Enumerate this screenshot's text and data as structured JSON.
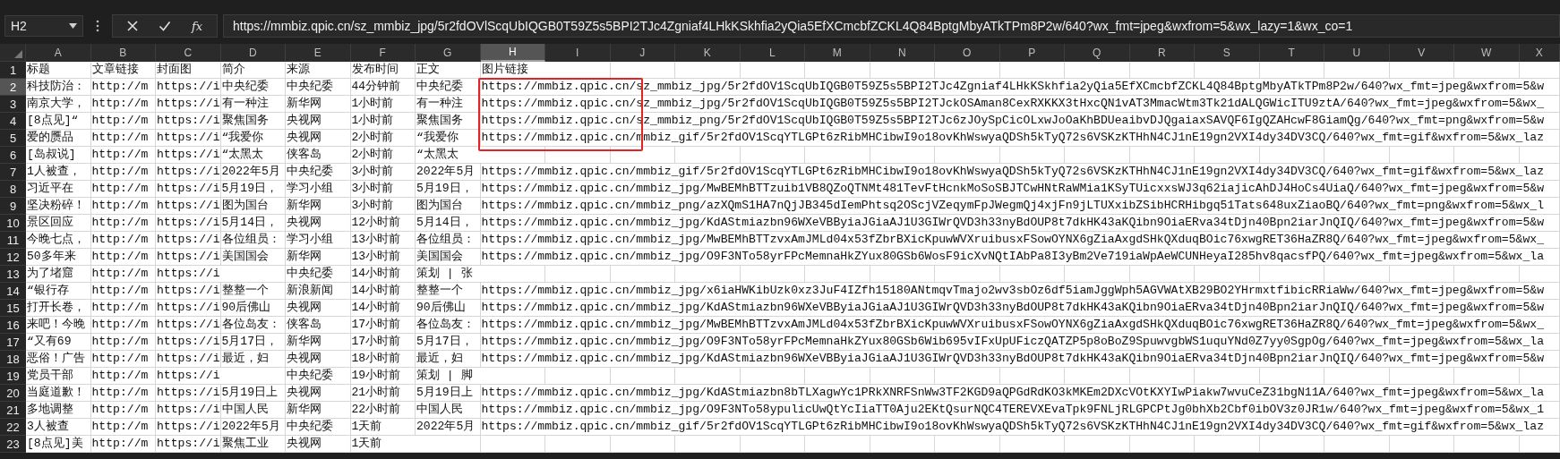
{
  "name_box": "H2",
  "formula_bar": {
    "buttons": [
      {
        "kind": "cancel"
      },
      {
        "kind": "enter"
      },
      {
        "kind": "function",
        "label": "fx"
      }
    ],
    "formula": "https://mmbiz.qpic.cn/sz_mmbiz_jpg/5r2fdOVlScqUbIQGB0T59Z5s5BPI2TJc4Zgniaf4LHkKSkhfia2yQia5EfXCmcbfZCKL4Q84BptgMbyATkTPm8P2w/640?wx_fmt=jpeg&wxfrom=5&wx_lazy=1&wx_co=1"
  },
  "columns": [
    {
      "label": "A",
      "selected": false
    },
    {
      "label": "B",
      "selected": false
    },
    {
      "label": "C",
      "selected": false
    },
    {
      "label": "D",
      "selected": false
    },
    {
      "label": "E",
      "selected": false
    },
    {
      "label": "F",
      "selected": false
    },
    {
      "label": "G",
      "selected": false
    },
    {
      "label": "H",
      "selected": true
    },
    {
      "label": "I",
      "selected": false
    },
    {
      "label": "J",
      "selected": false
    },
    {
      "label": "K",
      "selected": false
    },
    {
      "label": "L",
      "selected": false
    },
    {
      "label": "M",
      "selected": false
    },
    {
      "label": "N",
      "selected": false
    },
    {
      "label": "O",
      "selected": false
    },
    {
      "label": "P",
      "selected": false
    },
    {
      "label": "Q",
      "selected": false
    },
    {
      "label": "R",
      "selected": false
    },
    {
      "label": "S",
      "selected": false
    },
    {
      "label": "T",
      "selected": false
    },
    {
      "label": "U",
      "selected": false
    },
    {
      "label": "V",
      "selected": false
    },
    {
      "label": "W",
      "selected": false
    },
    {
      "label": "X",
      "selected": false
    }
  ],
  "rows": [
    {
      "number": "1",
      "selected": false,
      "boxed": false,
      "cells": {
        "A": "标题",
        "B": "文章链接",
        "C": "封面图",
        "D": "简介",
        "E": "来源",
        "F": "发布时间",
        "G": "正文",
        "H": "图片链接"
      }
    },
    {
      "number": "2",
      "selected": true,
      "boxed": true,
      "cells": {
        "A": "科技防治：",
        "B": "http://m",
        "C": "https://i",
        "D": "中央纪委",
        "E": "中央纪委",
        "F": "44分钟前",
        "G": "中央纪委",
        "H": "https://mmbiz.qpic.cn/sz_mmbiz_jpg/5r2fdOV1ScqUbIQGB0T59Z5s5BPI2TJc4Zgniaf4LHkKSkhfia2yQia5EfXCmcbfZCKL4Q84BptgMbyATkTPm8P2w/640?wx_fmt=jpeg&wxfrom=5&w"
      }
    },
    {
      "number": "3",
      "selected": false,
      "boxed": true,
      "cells": {
        "A": "南京大学，",
        "B": "http://m",
        "C": "https://i",
        "D": "有一种注",
        "E": "新华网",
        "F": "1小时前",
        "G": "有一种注",
        "H": "https://mmbiz.qpic.cn/sz_mmbiz_jpg/5r2fdOV1ScqUbIQGB0T59Z5s5BPI2TJckOSAman8CexRXKKX3tHxcQN1vAT3MmacWtm3Tk21dALQGWicITU9ztA/640?wx_fmt=jpeg&wxfrom=5&wx_"
      }
    },
    {
      "number": "4",
      "selected": false,
      "boxed": true,
      "cells": {
        "A": "[8点见]“",
        "B": "http://m",
        "C": "https://i",
        "D": "聚焦国务",
        "E": "央视网",
        "F": "1小时前",
        "G": "聚焦国务",
        "H": "https://mmbiz.qpic.cn/sz_mmbiz_png/5r2fdOV1ScqUbIQGB0T59Z5s5BPI2TJc6zJOySpCicOLxwJoOaKhBDUeaibvDJQgaiaxSAVQF6IgQZAHcwF8GiamQg/640?wx_fmt=png&wxfrom=5&w"
      }
    },
    {
      "number": "5",
      "selected": false,
      "boxed": true,
      "cells": {
        "A": "爱的赝品",
        "B": "http://m",
        "C": "https://i",
        "D": "“我爱你",
        "E": "央视网",
        "F": "2小时前",
        "G": "“我爱你",
        "H": "https://mmbiz.qpic.cn/mmbiz_gif/5r2fdOV1ScqYTLGPt6zRibMHCibwI9o18ovKhWswyaQDSh5kTyQ72s6VSKzKTHhN4CJ1nE19gn2VXI4dy34DV3CQ/640?wx_fmt=gif&wxfrom=5&wx_laz"
      }
    },
    {
      "number": "6",
      "selected": false,
      "boxed": false,
      "cells": {
        "A": "[岛叔说]",
        "B": "http://m",
        "C": "https://i",
        "D": "“太黑太",
        "E": "侠客岛",
        "F": "2小时前",
        "G": "“太黑太"
      }
    },
    {
      "number": "7",
      "selected": false,
      "boxed": false,
      "cells": {
        "A": "1人被查，",
        "B": "http://m",
        "C": "https://i",
        "D": "2022年5月",
        "E": "中央纪委",
        "F": "3小时前",
        "G": "2022年5月",
        "H": "https://mmbiz.qpic.cn/mmbiz_gif/5r2fdOV1ScqYTLGPt6zRibMHCibwI9o18ovKhWswyaQDSh5kTyQ72s6VSKzKTHhN4CJ1nE19gn2VXI4dy34DV3CQ/640?wx_fmt=gif&wxfrom=5&wx_laz"
      }
    },
    {
      "number": "8",
      "selected": false,
      "boxed": false,
      "cells": {
        "A": "习近平在",
        "B": "http://m",
        "C": "https://i",
        "D": "5月19日，",
        "E": "学习小组",
        "F": "3小时前",
        "G": "5月19日，",
        "H": "https://mmbiz.qpic.cn/mmbiz_jpg/MwBEMhBTTzuib1VB8QZoQTNMt481TevFtHcnkMoSoSBJTCwHNtRaWMia1KSyTUicxxsWJ3q62iajicAhDJ4HoCs4UiaQ/640?wx_fmt=jpeg&wxfrom=5&w"
      }
    },
    {
      "number": "9",
      "selected": false,
      "boxed": false,
      "cells": {
        "A": "坚决粉碎！",
        "B": "http://m",
        "C": "https://i",
        "D": "图为国台",
        "E": "新华网",
        "F": "3小时前",
        "G": "图为国台",
        "H": "https://mmbiz.qpic.cn/mmbiz_png/azXQmS1HA7nQjJB345dIemPhtsq2OScjVZeqymFpJWegmQj4xjFn9jLTUXxibZSibHCRHibgq51Tats648uxZiaoBQ/640?wx_fmt=png&wxfrom=5&wx_l"
      }
    },
    {
      "number": "10",
      "selected": false,
      "boxed": false,
      "cells": {
        "A": "景区回应",
        "B": "http://m",
        "C": "https://i",
        "D": "5月14日，",
        "E": "央视网",
        "F": "12小时前",
        "G": "5月14日，",
        "H": "https://mmbiz.qpic.cn/mmbiz_jpg/KdAStmiazbn96WXeVBByiaJGiaAJ1U3GIWrQVD3h33nyBdOUP8t7dkHK43aKQibn9OiaERva34tDjn40Bpn2iarJnQIQ/640?wx_fmt=jpeg&wxfrom=5&w"
      }
    },
    {
      "number": "11",
      "selected": false,
      "boxed": false,
      "cells": {
        "A": "今晚七点，",
        "B": "http://m",
        "C": "https://i",
        "D": "各位组员：",
        "E": "学习小组",
        "F": "13小时前",
        "G": "各位组员：",
        "H": "https://mmbiz.qpic.cn/mmbiz_jpg/MwBEMhBTTzvxAmJMLd04x53fZbrBXicKpuwWVXruibusxFSowOYNX6gZiaAxgdSHkQXduqBOic76xwgRET36HaZR8Q/640?wx_fmt=jpeg&wxfrom=5&wx_"
      }
    },
    {
      "number": "12",
      "selected": false,
      "boxed": false,
      "cells": {
        "A": "50多年来",
        "B": "http://m",
        "C": "https://i",
        "D": "美国国会",
        "E": "新华网",
        "F": "13小时前",
        "G": "美国国会",
        "H": "https://mmbiz.qpic.cn/mmbiz_jpg/O9F3NTo58yrFPcMemnaHkZYux80GSb6WosF9icXvNQtIAbPa8I3yBm2Ve719iaWpAeWCUNHeyaI285hv8qacsfPQ/640?wx_fmt=jpeg&wxfrom=5&wx_la"
      }
    },
    {
      "number": "13",
      "selected": false,
      "boxed": false,
      "cells": {
        "A": "为了堵窟",
        "B": "http://m",
        "C": "https://i",
        "E": "中央纪委",
        "F": "14小时前",
        "G": "策划 | 张"
      }
    },
    {
      "number": "14",
      "selected": false,
      "boxed": false,
      "cells": {
        "A": "“银行存",
        "B": "http://m",
        "C": "https://i",
        "D": "整整一个",
        "E": "新浪新闻",
        "F": "14小时前",
        "G": "整整一个",
        "H": "https://mmbiz.qpic.cn/mmbiz_jpg/x6iaHWKibUzk0xz3JuF4IZfh15180ANtmqvTmajo2wv3sbOz6df5iamJggWph5AGVWAtXB29BO2YHrmxtfibicRRiaWw/640?wx_fmt=jpeg&wxfrom=5&w"
      }
    },
    {
      "number": "15",
      "selected": false,
      "boxed": false,
      "cells": {
        "A": "打开长卷，",
        "B": "http://m",
        "C": "https://i",
        "D": "90后佛山",
        "E": "央视网",
        "F": "14小时前",
        "G": "90后佛山",
        "H": "https://mmbiz.qpic.cn/mmbiz_jpg/KdAStmiazbn96WXeVBByiaJGiaAJ1U3GIWrQVD3h33nyBdOUP8t7dkHK43aKQibn9OiaERva34tDjn40Bpn2iarJnQIQ/640?wx_fmt=jpeg&wxfrom=5&w"
      }
    },
    {
      "number": "16",
      "selected": false,
      "boxed": false,
      "cells": {
        "A": "来吧！今晚",
        "B": "http://m",
        "C": "https://i",
        "D": "各位岛友：",
        "E": "侠客岛",
        "F": "17小时前",
        "G": "各位岛友：",
        "H": "https://mmbiz.qpic.cn/mmbiz_jpg/MwBEMhBTTzvxAmJMLd04x53fZbrBXicKpuwWVXruibusxFSowOYNX6gZiaAxgdSHkQXduqBOic76xwgRET36HaZR8Q/640?wx_fmt=jpeg&wxfrom=5&wx_"
      }
    },
    {
      "number": "17",
      "selected": false,
      "boxed": false,
      "cells": {
        "A": "“又有69",
        "B": "http://m",
        "C": "https://i",
        "D": "5月17日，",
        "E": "新华网",
        "F": "17小时前",
        "G": "5月17日，",
        "H": "https://mmbiz.qpic.cn/mmbiz_jpg/O9F3NTo58yrFPcMemnaHkZYux80GSb6Wib695vIFxUpUFiczQATZP5p8oBoZ9SpuwvgbWS1uquYNd0Z7yy0SgpOg/640?wx_fmt=jpeg&wxfrom=5&wx_la"
      }
    },
    {
      "number": "18",
      "selected": false,
      "boxed": false,
      "cells": {
        "A": "恶俗！广告",
        "B": "http://m",
        "C": "https://i",
        "D": "最近，妇",
        "E": "央视网",
        "F": "18小时前",
        "G": "最近，妇",
        "H": "https://mmbiz.qpic.cn/mmbiz_jpg/KdAStmiazbn96WXeVBByiaJGiaAJ1U3GIWrQVD3h33nyBdOUP8t7dkHK43aKQibn9OiaERva34tDjn40Bpn2iarJnQIQ/640?wx_fmt=jpeg&wxfrom=5&w"
      }
    },
    {
      "number": "19",
      "selected": false,
      "boxed": false,
      "cells": {
        "A": "党员干部",
        "B": "http://m",
        "C": "https://i",
        "E": "中央纪委",
        "F": "19小时前",
        "G": "策划 | 脚"
      }
    },
    {
      "number": "20",
      "selected": false,
      "boxed": false,
      "cells": {
        "A": "当庭道歉！",
        "B": "http://m",
        "C": "https://i",
        "D": "5月19日上",
        "E": "央视网",
        "F": "21小时前",
        "G": "5月19日上",
        "H": "https://mmbiz.qpic.cn/mmbiz_jpg/KdAStmiazbn8bTLXagwYc1PRkXNRFSnWw3TF2KGD9aQPGdRdKO3kMKEm2DXcVOtKXYIwPiakw7wvuCeZ31bgN11A/640?wx_fmt=jpeg&wxfrom=5&wx_la"
      }
    },
    {
      "number": "21",
      "selected": false,
      "boxed": false,
      "cells": {
        "A": "多地调整",
        "B": "http://m",
        "C": "https://i",
        "D": "中国人民",
        "E": "新华网",
        "F": "22小时前",
        "G": "中国人民",
        "H": "https://mmbiz.qpic.cn/mmbiz_jpg/O9F3NTo58ypulicUwQtYcIiaTT0Aju2EKtQsurNQC4TEREVXEvaTpk9FNLjRLGPCPtJg0bhXb2Cbf0ibOV3z0JR1w/640?wx_fmt=jpeg&wxfrom=5&wx_1"
      }
    },
    {
      "number": "22",
      "selected": false,
      "boxed": false,
      "cells": {
        "A": "3人被查",
        "B": "http://m",
        "C": "https://i",
        "D": "2022年5月",
        "E": "中央纪委",
        "F": "1天前",
        "G": "2022年5月",
        "H": "https://mmbiz.qpic.cn/mmbiz_gif/5r2fdOV1ScqYTLGPt6zRibMHCibwI9o18ovKhWswyaQDSh5kTyQ72s6VSKzKTHhN4CJ1nE19gn2VXI4dy34DV3CQ/640?wx_fmt=gif&wxfrom=5&wx_laz"
      }
    },
    {
      "number": "23",
      "selected": false,
      "boxed": false,
      "cells": {
        "A": "[8点见]美",
        "B": "http://m",
        "C": "https://i",
        "D": "聚焦工业",
        "E": "央视网",
        "F": "1天前"
      }
    }
  ]
}
